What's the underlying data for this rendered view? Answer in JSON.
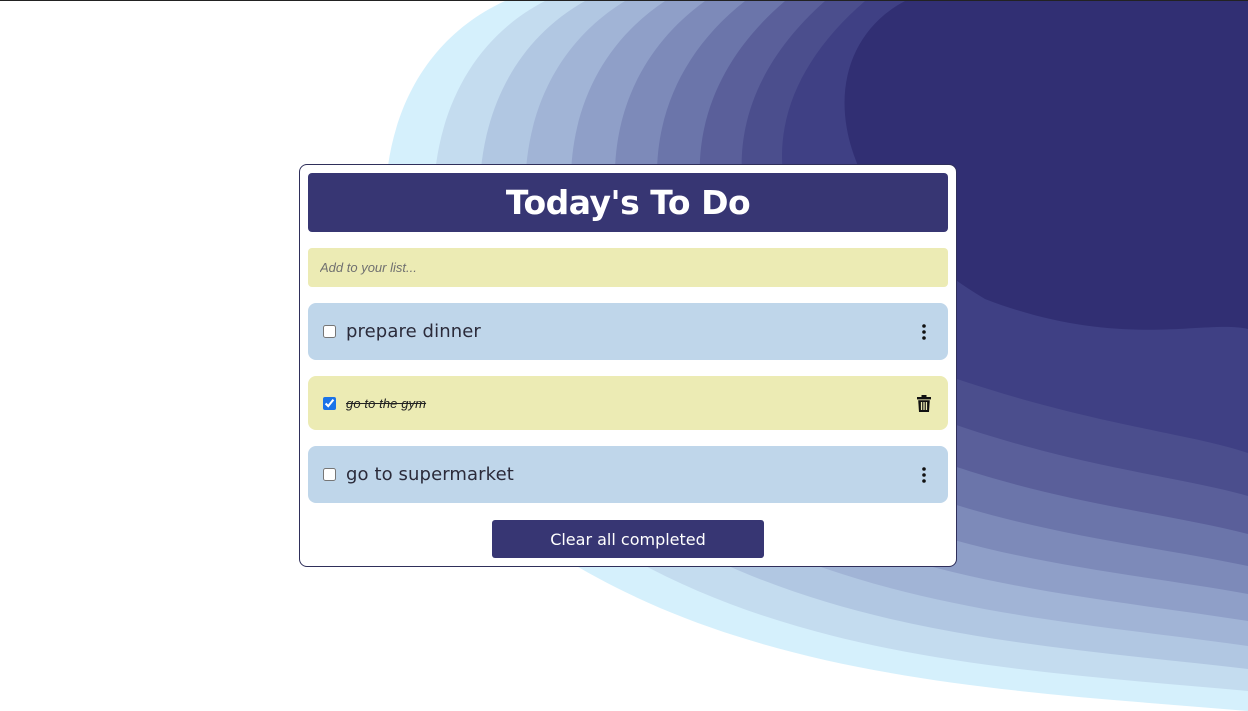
{
  "app": {
    "title": "Today's To Do"
  },
  "input": {
    "placeholder": "Add to your list...",
    "value": ""
  },
  "tasks": [
    {
      "label": "prepare dinner",
      "completed": false,
      "action_icon": "more-vertical-icon"
    },
    {
      "label": "go to the gym",
      "completed": true,
      "action_icon": "trash-icon"
    },
    {
      "label": "go to supermarket",
      "completed": false,
      "action_icon": "more-vertical-icon"
    }
  ],
  "footer": {
    "clear_label": "Clear all completed"
  },
  "colors": {
    "primary": "#373673",
    "pending_task": "#bfd6ea",
    "done_task": "#ecebb4",
    "input_bg": "#ecebb4",
    "wave_dark": "#312f73",
    "wave_light": "#d5f0fc"
  }
}
